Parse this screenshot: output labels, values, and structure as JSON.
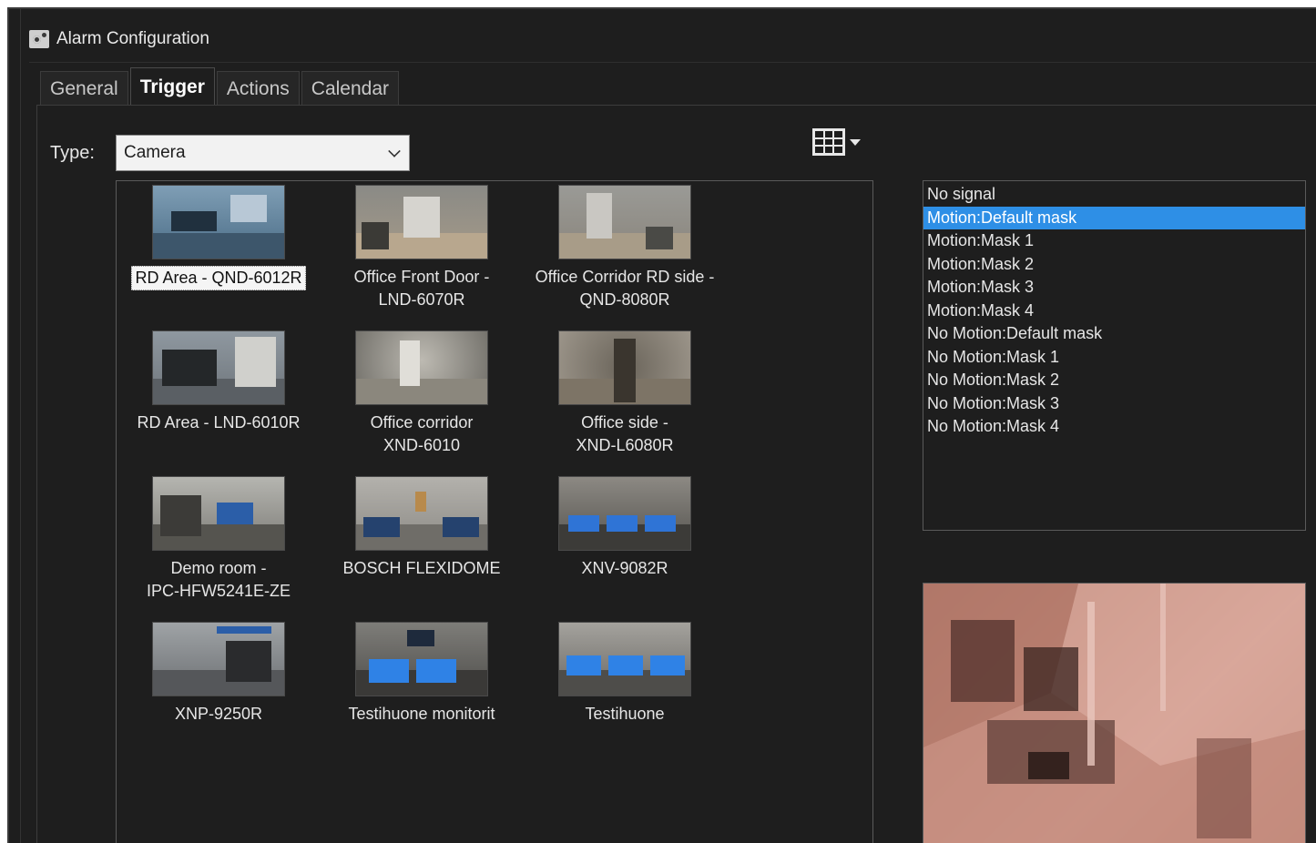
{
  "window": {
    "title": "Alarm Configuration"
  },
  "tabs": [
    {
      "label": "General",
      "active": false
    },
    {
      "label": "Trigger",
      "active": true
    },
    {
      "label": "Actions",
      "active": false
    },
    {
      "label": "Calendar",
      "active": false
    }
  ],
  "type_field": {
    "label": "Type:",
    "value": "Camera"
  },
  "layout_button": {
    "icon": "grid-3x3-icon"
  },
  "cameras": [
    {
      "line1": "RD Area - QND-6012R",
      "line2": "",
      "selected": true
    },
    {
      "line1": "Office Front Door -",
      "line2": "LND-6070R",
      "selected": false
    },
    {
      "line1": "Office Corridor RD side -",
      "line2": "QND-8080R",
      "selected": false
    },
    {
      "line1": "RD Area - LND-6010R",
      "line2": "",
      "selected": false
    },
    {
      "line1": "Office corridor",
      "line2": "XND-6010",
      "selected": false
    },
    {
      "line1": "Office side -",
      "line2": "XND-L6080R",
      "selected": false
    },
    {
      "line1": "Demo room -",
      "line2": "IPC-HFW5241E-ZE",
      "selected": false
    },
    {
      "line1": "BOSCH FLEXIDOME",
      "line2": "",
      "selected": false
    },
    {
      "line1": "XNV-9082R",
      "line2": "",
      "selected": false
    },
    {
      "line1": "XNP-9250R",
      "line2": "",
      "selected": false
    },
    {
      "line1": "Testihuone monitorit",
      "line2": "",
      "selected": false
    },
    {
      "line1": "Testihuone",
      "line2": "",
      "selected": false
    }
  ],
  "events": [
    {
      "label": "No signal",
      "selected": false
    },
    {
      "label": "Motion:Default mask",
      "selected": true
    },
    {
      "label": "Motion:Mask 1",
      "selected": false
    },
    {
      "label": "Motion:Mask 2",
      "selected": false
    },
    {
      "label": "Motion:Mask 3",
      "selected": false
    },
    {
      "label": "Motion:Mask 4",
      "selected": false
    },
    {
      "label": "No Motion:Default mask",
      "selected": false
    },
    {
      "label": "No Motion:Mask 1",
      "selected": false
    },
    {
      "label": "No Motion:Mask 2",
      "selected": false
    },
    {
      "label": "No Motion:Mask 3",
      "selected": false
    },
    {
      "label": "No Motion:Mask 4",
      "selected": false
    }
  ],
  "colors": {
    "accent": "#2e8fe6",
    "background": "#1e1e1e",
    "preview_tint": "#c48a7c"
  }
}
